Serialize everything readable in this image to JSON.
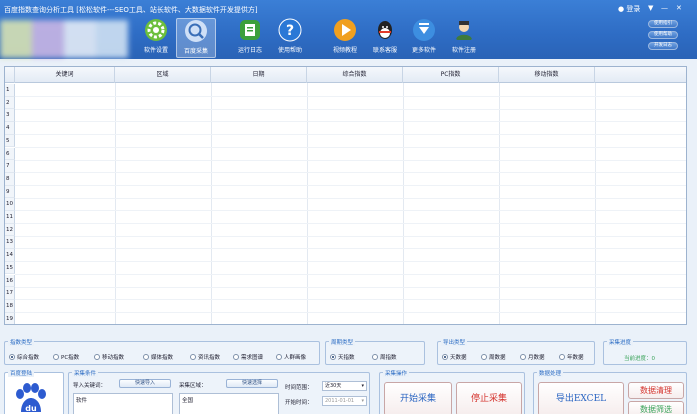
{
  "window": {
    "title": "百度指数查询分析工具 [松松软件---SEO工具、站长软件、大数据软件开发提供方]",
    "login_label": "登录",
    "controls": [
      "▼",
      "—",
      "✕"
    ]
  },
  "toolbar": [
    {
      "label": "软件设置",
      "icon": "gear-icon",
      "color": "#6cbf3c"
    },
    {
      "label": "百度采集",
      "icon": "search-icon",
      "color": "#7aa8de",
      "active": true
    },
    {
      "label": "运行日志",
      "icon": "log-icon",
      "color": "#3c9f3c"
    },
    {
      "label": "使用帮助",
      "icon": "help-icon",
      "color": "#2a78d6"
    },
    {
      "label": "视频教程",
      "icon": "play-icon",
      "color": "#f0a020"
    },
    {
      "label": "联系客服",
      "icon": "qq-icon",
      "color": "#222222"
    },
    {
      "label": "更多软件",
      "icon": "download-icon",
      "color": "#3d8ee0"
    },
    {
      "label": "软件注册",
      "icon": "user-icon",
      "color": "#3e7a3e"
    }
  ],
  "side_buttons": [
    "使用指引",
    "使用帮助",
    "开发日志"
  ],
  "grid": {
    "columns": [
      "关键词",
      "区域",
      "日期",
      "综合指数",
      "PC指数",
      "移动指数"
    ],
    "rows": [
      "1",
      "2",
      "3",
      "4",
      "5",
      "6",
      "7",
      "8",
      "9",
      "10",
      "11",
      "12",
      "13",
      "14",
      "15",
      "16",
      "17",
      "18",
      "19"
    ]
  },
  "index_type": {
    "title": "指数类型",
    "options": [
      "综合指数",
      "PC指数",
      "移动指数",
      "媒体指数",
      "资讯指数",
      "需求图谱",
      "人群画像"
    ],
    "selected": 0
  },
  "period_type": {
    "title": "周期类型",
    "options": [
      "天指数",
      "周指数"
    ],
    "selected": 0
  },
  "export_type": {
    "title": "导出类型",
    "options": [
      "天数据",
      "周数据",
      "月数据",
      "年数据"
    ],
    "selected": 0
  },
  "progress": {
    "title": "采集进度",
    "text": "当前进度：0"
  },
  "baidu_login": {
    "title": "百度登陆"
  },
  "conditions": {
    "title": "采集条件",
    "import_label": "导入关键词：",
    "quick_import": "快速导入",
    "keywords_value": "软件",
    "region_label": "采集区域：",
    "quick_select": "快速选择",
    "region_value": "全国",
    "range_label": "时间范围：",
    "range_value": "近30天",
    "start_label": "开始时间：",
    "start_value": "2011-01-01"
  },
  "operations": {
    "title": "采集操作",
    "start": "开始采集",
    "stop": "停止采集"
  },
  "data_process": {
    "title": "数据处理",
    "export": "导出EXCEL",
    "clean": "数据清理",
    "filter": "数据筛选"
  }
}
